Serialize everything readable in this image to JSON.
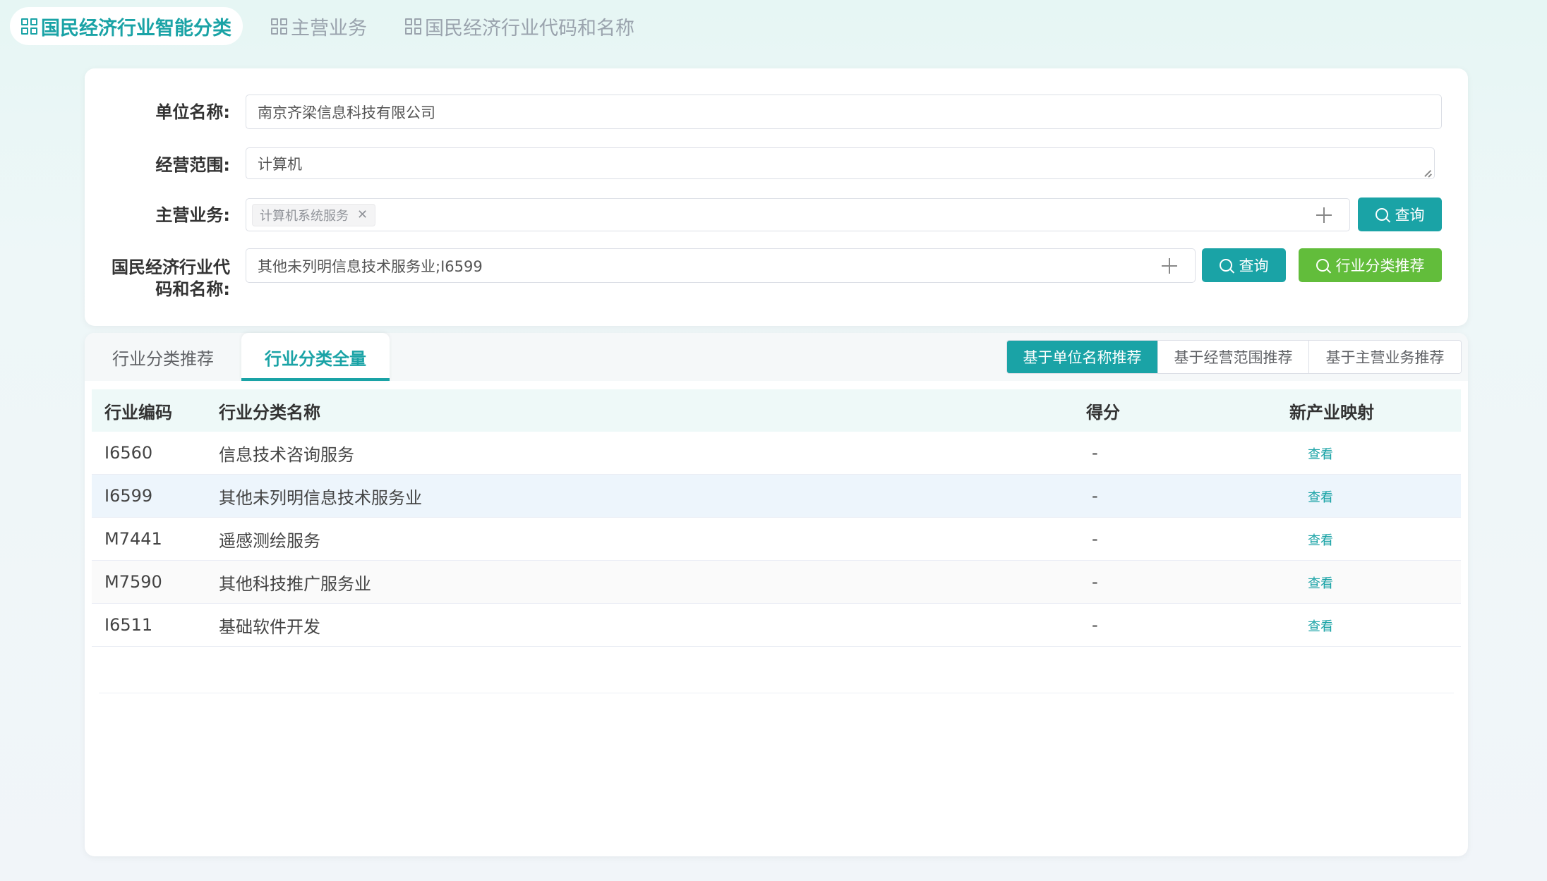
{
  "top_tabs": [
    {
      "label": "国民经济行业智能分类",
      "active": true
    },
    {
      "label": "主营业务",
      "active": false
    },
    {
      "label": "国民经济行业代码和名称",
      "active": false
    }
  ],
  "form": {
    "unit_name_label": "单位名称:",
    "unit_name_value": "南京齐梁信息科技有限公司",
    "scope_label": "经营范围:",
    "scope_value": "计算机",
    "main_business_label": "主营业务:",
    "main_business_tags": [
      "计算机系统服务"
    ],
    "industry_label_line1": "国民经济行业代",
    "industry_label_line2": "码和名称:",
    "industry_value": "其他未列明信息技术服务业;I6599",
    "query_label": "查询",
    "recommend_label": "行业分类推荐"
  },
  "result": {
    "tabs": [
      {
        "label": "行业分类推荐",
        "active": false
      },
      {
        "label": "行业分类全量",
        "active": true
      }
    ],
    "segments": [
      {
        "label": "基于单位名称推荐",
        "active": true
      },
      {
        "label": "基于经营范围推荐",
        "active": false
      },
      {
        "label": "基于主营业务推荐",
        "active": false
      }
    ],
    "columns": [
      "行业编码",
      "行业分类名称",
      "得分",
      "新产业映射"
    ],
    "rows": [
      {
        "code": "I6560",
        "name": "信息技术咨询服务",
        "score": "-",
        "action": "查看"
      },
      {
        "code": "I6599",
        "name": "其他未列明信息技术服务业",
        "score": "-",
        "action": "查看"
      },
      {
        "code": "M7441",
        "name": "遥感测绘服务",
        "score": "-",
        "action": "查看"
      },
      {
        "code": "M7590",
        "name": "其他科技推广服务业",
        "score": "-",
        "action": "查看"
      },
      {
        "code": "I6511",
        "name": "基础软件开发",
        "score": "-",
        "action": "查看"
      }
    ]
  },
  "colors": {
    "accent": "#1aa3a6",
    "green": "#62bd3b",
    "hover_row": "#edf5fc"
  }
}
